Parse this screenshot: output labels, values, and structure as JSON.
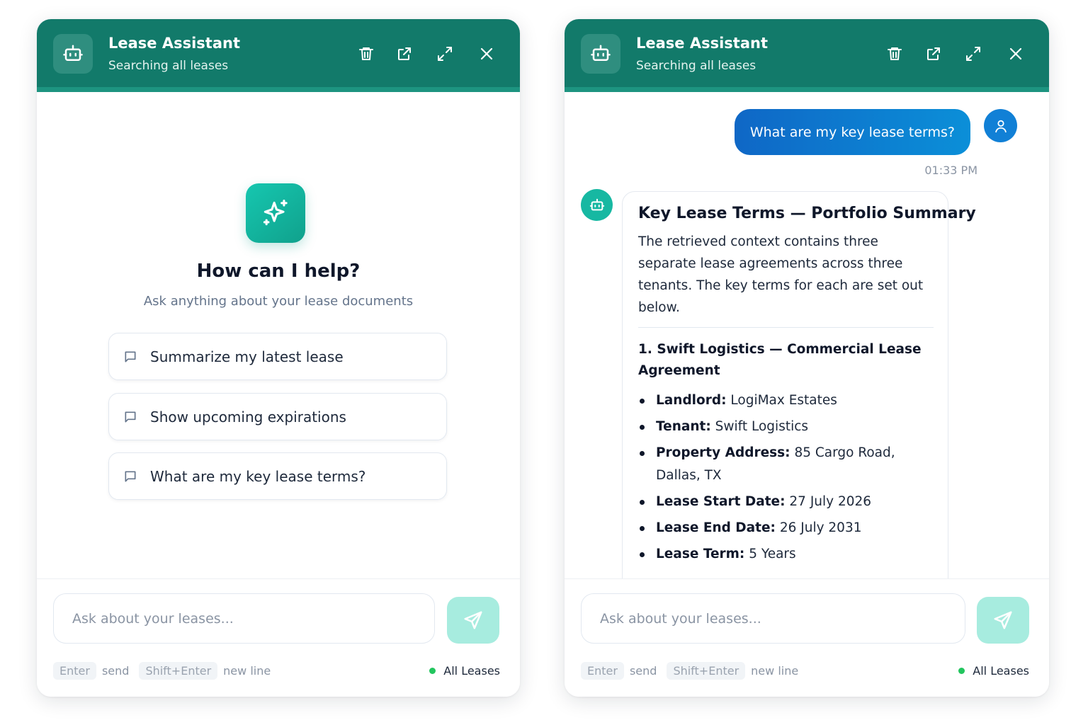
{
  "assistant": {
    "title": "Lease Assistant",
    "subtitle": "Searching all leases",
    "header_icons": [
      "trash-icon",
      "external-link-icon",
      "expand-icon",
      "close-icon"
    ]
  },
  "welcome": {
    "title": "How can I help?",
    "subtitle": "Ask anything about your lease documents",
    "suggestions": [
      {
        "label": "Summarize my latest lease"
      },
      {
        "label": "Show upcoming expirations"
      },
      {
        "label": "What are my key lease terms?"
      }
    ]
  },
  "composer": {
    "placeholder": "Ask about your leases...",
    "hint_enter_key": "Enter",
    "hint_enter_action": "send",
    "hint_newline_key": "Shift+Enter",
    "hint_newline_action": "new line",
    "scope_label": "All Leases",
    "scope_color": "#22c55e"
  },
  "conversation": {
    "user_message": "What are my key lease terms?",
    "user_time": "01:33 PM",
    "reply": {
      "title": "Key Lease Terms — Portfolio Summary",
      "intro": "The retrieved context contains three separate lease agreements across three tenants. The key terms for each are set out below.",
      "section_title": "1. Swift Logistics — Commercial Lease Agreement",
      "terms": [
        {
          "label": "Landlord:",
          "value": "LogiMax Estates"
        },
        {
          "label": "Tenant:",
          "value": "Swift Logistics"
        },
        {
          "label": "Property Address:",
          "value": "85 Cargo Road, Dallas, TX"
        },
        {
          "label": "Lease Start Date:",
          "value": "27 July 2026"
        },
        {
          "label": "Lease End Date:",
          "value": "26 July 2031"
        },
        {
          "label": "Lease Term:",
          "value": "5 Years"
        }
      ]
    }
  },
  "colors": {
    "header": "#127a6a",
    "user_bubble": "#0f67c6",
    "bot_avatar": "#17b8a2",
    "send_button": "#a7ecdf"
  }
}
